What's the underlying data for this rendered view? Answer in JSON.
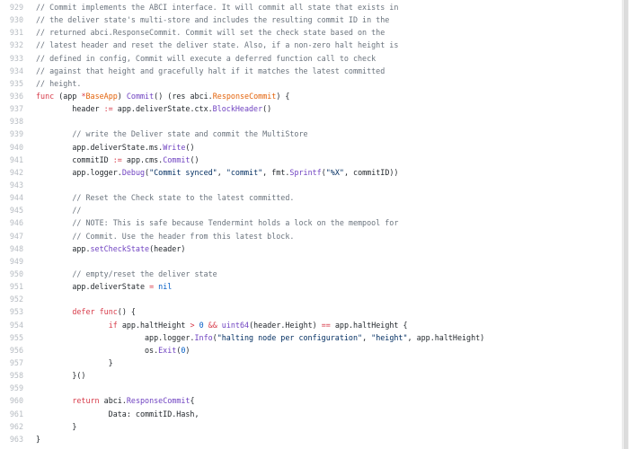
{
  "editor": {
    "lines": [
      {
        "number": "929",
        "tokens": [
          {
            "t": "// Commit implements the ABCI interface. It will commit all state that exists in",
            "c": "comment"
          }
        ]
      },
      {
        "number": "930",
        "tokens": [
          {
            "t": "// the deliver state's multi-store and includes the resulting commit ID in the",
            "c": "comment"
          }
        ]
      },
      {
        "number": "931",
        "tokens": [
          {
            "t": "// returned abci.ResponseCommit. Commit will set the check state based on the",
            "c": "comment"
          }
        ]
      },
      {
        "number": "932",
        "tokens": [
          {
            "t": "// latest header and reset the deliver state. Also, if a non-zero halt height is",
            "c": "comment"
          }
        ]
      },
      {
        "number": "933",
        "tokens": [
          {
            "t": "// defined in config, Commit will execute a deferred function call to check",
            "c": "comment"
          }
        ]
      },
      {
        "number": "934",
        "tokens": [
          {
            "t": "// against that height and gracefully halt if it matches the latest committed",
            "c": "comment"
          }
        ]
      },
      {
        "number": "935",
        "tokens": [
          {
            "t": "// height.",
            "c": "comment"
          }
        ]
      },
      {
        "number": "936",
        "tokens": [
          {
            "t": "func",
            "c": "keyword"
          },
          {
            "t": " (",
            "c": "plain"
          },
          {
            "t": "app",
            "c": "plain"
          },
          {
            "t": " *",
            "c": "keyword"
          },
          {
            "t": "BaseApp",
            "c": "param"
          },
          {
            "t": ") ",
            "c": "plain"
          },
          {
            "t": "Commit",
            "c": "entity"
          },
          {
            "t": "() (",
            "c": "plain"
          },
          {
            "t": "res",
            "c": "plain"
          },
          {
            "t": " abci.",
            "c": "plain"
          },
          {
            "t": "ResponseCommit",
            "c": "param"
          },
          {
            "t": ") {",
            "c": "plain"
          }
        ]
      },
      {
        "number": "937",
        "tokens": [
          {
            "t": "        header ",
            "c": "plain"
          },
          {
            "t": ":=",
            "c": "keyword"
          },
          {
            "t": " app.deliverState.ctx.",
            "c": "plain"
          },
          {
            "t": "BlockHeader",
            "c": "entity"
          },
          {
            "t": "()",
            "c": "plain"
          }
        ]
      },
      {
        "number": "938",
        "tokens": [
          {
            "t": "",
            "c": "plain"
          }
        ]
      },
      {
        "number": "939",
        "tokens": [
          {
            "t": "        // write the Deliver state and commit the MultiStore",
            "c": "comment"
          }
        ]
      },
      {
        "number": "940",
        "tokens": [
          {
            "t": "        app.deliverState.ms.",
            "c": "plain"
          },
          {
            "t": "Write",
            "c": "entity"
          },
          {
            "t": "()",
            "c": "plain"
          }
        ]
      },
      {
        "number": "941",
        "tokens": [
          {
            "t": "        commitID ",
            "c": "plain"
          },
          {
            "t": ":=",
            "c": "keyword"
          },
          {
            "t": " app.cms.",
            "c": "plain"
          },
          {
            "t": "Commit",
            "c": "entity"
          },
          {
            "t": "()",
            "c": "plain"
          }
        ]
      },
      {
        "number": "942",
        "tokens": [
          {
            "t": "        app.logger.",
            "c": "plain"
          },
          {
            "t": "Debug",
            "c": "entity"
          },
          {
            "t": "(",
            "c": "plain"
          },
          {
            "t": "\"Commit synced\"",
            "c": "string"
          },
          {
            "t": ", ",
            "c": "plain"
          },
          {
            "t": "\"commit\"",
            "c": "string"
          },
          {
            "t": ", fmt.",
            "c": "plain"
          },
          {
            "t": "Sprintf",
            "c": "entity"
          },
          {
            "t": "(",
            "c": "plain"
          },
          {
            "t": "\"%X\"",
            "c": "string"
          },
          {
            "t": ", commitID))",
            "c": "plain"
          }
        ]
      },
      {
        "number": "943",
        "tokens": [
          {
            "t": "",
            "c": "plain"
          }
        ]
      },
      {
        "number": "944",
        "tokens": [
          {
            "t": "        // Reset the Check state to the latest committed.",
            "c": "comment"
          }
        ]
      },
      {
        "number": "945",
        "tokens": [
          {
            "t": "        //",
            "c": "comment"
          }
        ]
      },
      {
        "number": "946",
        "tokens": [
          {
            "t": "        // NOTE: This is safe because Tendermint holds a lock on the mempool for",
            "c": "comment"
          }
        ]
      },
      {
        "number": "947",
        "tokens": [
          {
            "t": "        // Commit. Use the header from this latest block.",
            "c": "comment"
          }
        ]
      },
      {
        "number": "948",
        "tokens": [
          {
            "t": "        app.",
            "c": "plain"
          },
          {
            "t": "setCheckState",
            "c": "entity"
          },
          {
            "t": "(header)",
            "c": "plain"
          }
        ]
      },
      {
        "number": "949",
        "tokens": [
          {
            "t": "",
            "c": "plain"
          }
        ]
      },
      {
        "number": "950",
        "tokens": [
          {
            "t": "        // empty/reset the deliver state",
            "c": "comment"
          }
        ]
      },
      {
        "number": "951",
        "tokens": [
          {
            "t": "        app.deliverState ",
            "c": "plain"
          },
          {
            "t": "=",
            "c": "keyword"
          },
          {
            "t": " ",
            "c": "plain"
          },
          {
            "t": "nil",
            "c": "constant"
          }
        ]
      },
      {
        "number": "952",
        "tokens": [
          {
            "t": "",
            "c": "plain"
          }
        ]
      },
      {
        "number": "953",
        "tokens": [
          {
            "t": "        ",
            "c": "plain"
          },
          {
            "t": "defer",
            "c": "keyword"
          },
          {
            "t": " ",
            "c": "plain"
          },
          {
            "t": "func",
            "c": "keyword"
          },
          {
            "t": "() {",
            "c": "plain"
          }
        ]
      },
      {
        "number": "954",
        "tokens": [
          {
            "t": "                ",
            "c": "plain"
          },
          {
            "t": "if",
            "c": "keyword"
          },
          {
            "t": " app.haltHeight ",
            "c": "plain"
          },
          {
            "t": ">",
            "c": "keyword"
          },
          {
            "t": " ",
            "c": "plain"
          },
          {
            "t": "0",
            "c": "constant"
          },
          {
            "t": " ",
            "c": "plain"
          },
          {
            "t": "&&",
            "c": "keyword"
          },
          {
            "t": " ",
            "c": "plain"
          },
          {
            "t": "uint64",
            "c": "entity"
          },
          {
            "t": "(header.Height) ",
            "c": "plain"
          },
          {
            "t": "==",
            "c": "keyword"
          },
          {
            "t": " app.haltHeight {",
            "c": "plain"
          }
        ]
      },
      {
        "number": "955",
        "tokens": [
          {
            "t": "                        app.logger.",
            "c": "plain"
          },
          {
            "t": "Info",
            "c": "entity"
          },
          {
            "t": "(",
            "c": "plain"
          },
          {
            "t": "\"halting node per configuration\"",
            "c": "string"
          },
          {
            "t": ", ",
            "c": "plain"
          },
          {
            "t": "\"height\"",
            "c": "string"
          },
          {
            "t": ", app.haltHeight)",
            "c": "plain"
          }
        ]
      },
      {
        "number": "956",
        "tokens": [
          {
            "t": "                        os.",
            "c": "plain"
          },
          {
            "t": "Exit",
            "c": "entity"
          },
          {
            "t": "(",
            "c": "plain"
          },
          {
            "t": "0",
            "c": "constant"
          },
          {
            "t": ")",
            "c": "plain"
          }
        ]
      },
      {
        "number": "957",
        "tokens": [
          {
            "t": "                }",
            "c": "plain"
          }
        ]
      },
      {
        "number": "958",
        "tokens": [
          {
            "t": "        }()",
            "c": "plain"
          }
        ]
      },
      {
        "number": "959",
        "tokens": [
          {
            "t": "",
            "c": "plain"
          }
        ]
      },
      {
        "number": "960",
        "tokens": [
          {
            "t": "        ",
            "c": "plain"
          },
          {
            "t": "return",
            "c": "keyword"
          },
          {
            "t": " abci.",
            "c": "plain"
          },
          {
            "t": "ResponseCommit",
            "c": "entity"
          },
          {
            "t": "{",
            "c": "plain"
          }
        ]
      },
      {
        "number": "961",
        "tokens": [
          {
            "t": "                Data: commitID.Hash,",
            "c": "plain"
          }
        ]
      },
      {
        "number": "962",
        "tokens": [
          {
            "t": "        }",
            "c": "plain"
          }
        ]
      },
      {
        "number": "963",
        "tokens": [
          {
            "t": "}",
            "c": "plain"
          }
        ]
      }
    ]
  }
}
